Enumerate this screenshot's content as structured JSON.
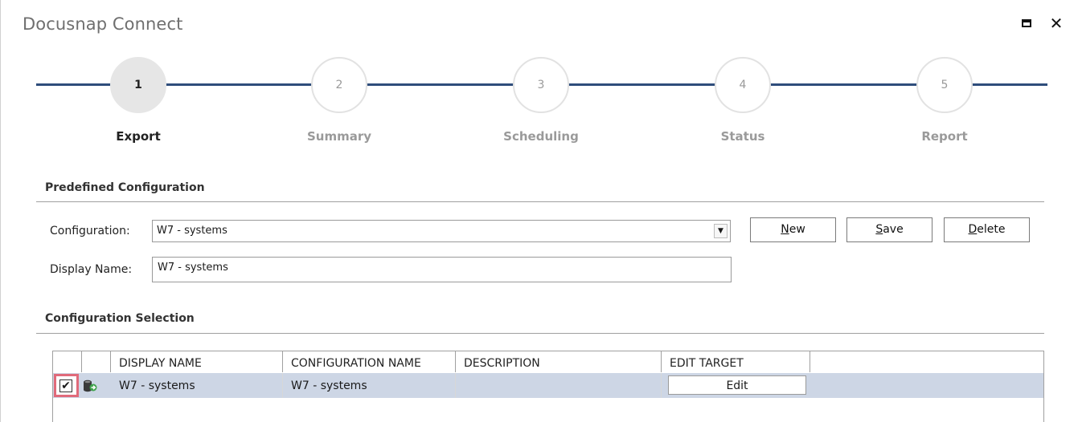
{
  "window": {
    "title": "Docusnap Connect",
    "maximize_icon": "maximize-icon",
    "close_glyph": "✕"
  },
  "stepper": {
    "steps": [
      {
        "number": "1",
        "label": "Export",
        "active": true
      },
      {
        "number": "2",
        "label": "Summary",
        "active": false
      },
      {
        "number": "3",
        "label": "Scheduling",
        "active": false
      },
      {
        "number": "4",
        "label": "Status",
        "active": false
      },
      {
        "number": "5",
        "label": "Report",
        "active": false
      }
    ],
    "line_color": "#2e4d7b"
  },
  "predefined": {
    "section_title": "Predefined Configuration",
    "configuration_label": "Configuration:",
    "configuration_value": "W7 - systems",
    "display_name_label": "Display Name:",
    "display_name_value": "W7 - systems",
    "buttons": {
      "new_underline": "N",
      "new_rest": "ew",
      "save_underline": "S",
      "save_rest": "ave",
      "delete_underline": "D",
      "delete_rest": "elete"
    }
  },
  "selection": {
    "section_title": "Configuration Selection",
    "columns": [
      "DISPLAY NAME",
      "CONFIGURATION NAME",
      "DESCRIPTION",
      "EDIT TARGET"
    ],
    "rows": [
      {
        "checked": true,
        "check_glyph": "✔",
        "icon": "database-export-icon",
        "display_name": "W7 - systems",
        "configuration_name": "W7 - systems",
        "description": "",
        "edit_label": "Edit"
      }
    ],
    "selected_row_color": "#cdd6e5",
    "highlight_color": "#e06a7a"
  }
}
